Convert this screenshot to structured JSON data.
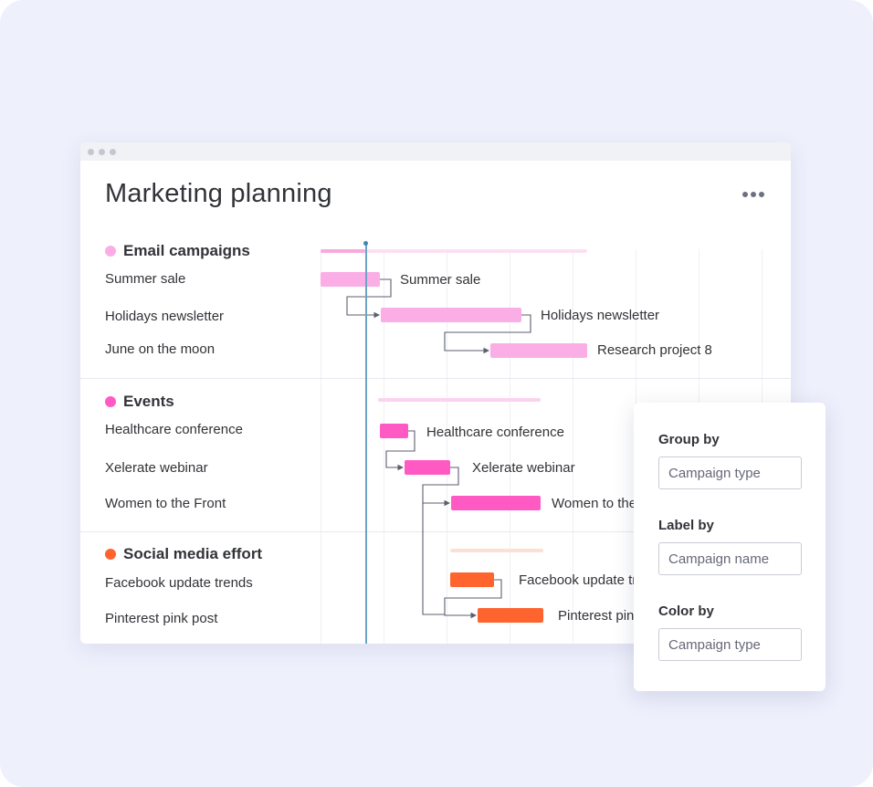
{
  "page": {
    "title": "Marketing planning"
  },
  "colors": {
    "email": "#fbaee6",
    "events": "#ff5ac4",
    "social": "#ff642e",
    "today_line": "#6aa5c8",
    "background": "#eef0fc"
  },
  "groups": [
    {
      "title": "Email campaigns",
      "color": "#fbaee6",
      "items": [
        {
          "name": "Summer sale",
          "bar_label": "Summer sale"
        },
        {
          "name": "Holidays newsletter",
          "bar_label": "Holidays newsletter"
        },
        {
          "name": "June on the moon",
          "bar_label": "Research project 8"
        }
      ]
    },
    {
      "title": "Events",
      "color": "#ff5ac4",
      "items": [
        {
          "name": "Healthcare conference",
          "bar_label": "Healthcare conference"
        },
        {
          "name": "Xelerate webinar",
          "bar_label": "Xelerate webinar"
        },
        {
          "name": "Women to the Front",
          "bar_label": "Women to the"
        }
      ]
    },
    {
      "title": "Social media effort",
      "color": "#ff642e",
      "items": [
        {
          "name": "Facebook update trends",
          "bar_label": "Facebook update tr"
        },
        {
          "name": "Pinterest pink post",
          "bar_label": "Pinterest pin"
        }
      ]
    }
  ],
  "settings_panel": {
    "group_by": {
      "label": "Group by",
      "placeholder": "Campaign type"
    },
    "label_by": {
      "label": "Label by",
      "placeholder": "Campaign name"
    },
    "color_by": {
      "label": "Color by",
      "placeholder": "Campaign type"
    }
  },
  "icons": {
    "menu": "more-horizontal-icon",
    "window": "window-dots-icon"
  }
}
